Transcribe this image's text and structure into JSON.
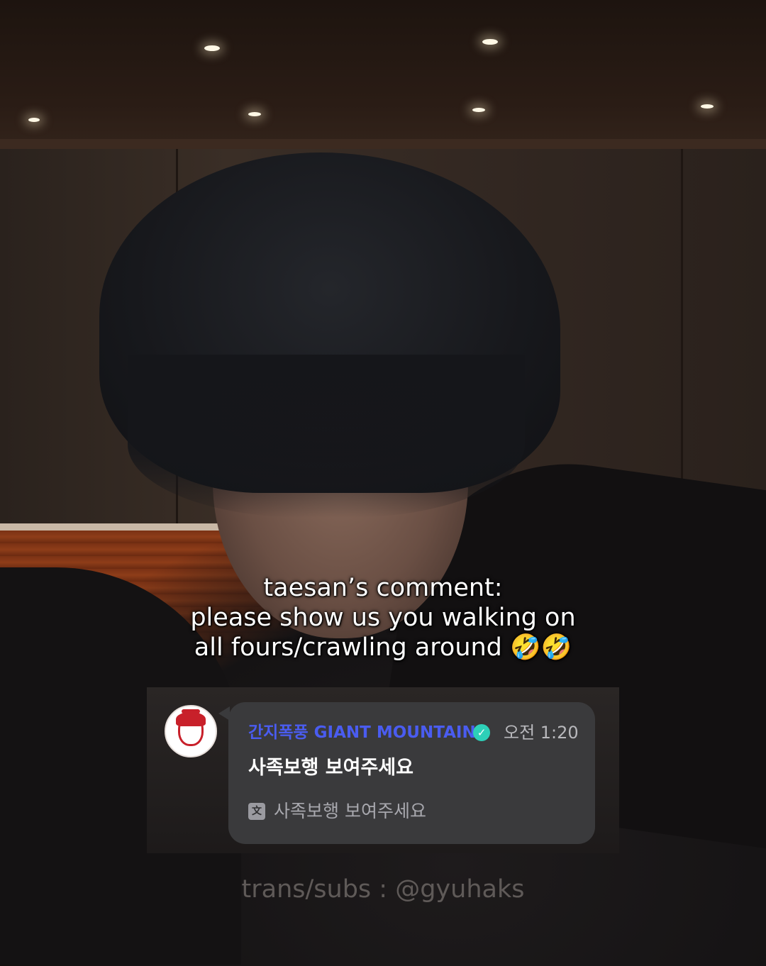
{
  "caption": {
    "line1": "taesan’s comment:",
    "line2": "please show us you walking on",
    "line3": "all fours/crawling around 🤣🤣"
  },
  "comment": {
    "username": "간지폭풍 GIANT MOUNTAIN",
    "verified_icon": "verified-check-icon",
    "time": "오전 1:20",
    "message": "사족보행 보여주세요",
    "translate_icon": "translate-icon",
    "translation": "사족보행 보여주세요"
  },
  "credit": "trans/subs : @gyuhaks",
  "colors": {
    "username": "#4a5cf0",
    "verified": "#2dd0b8",
    "bubble": "#3a3a3c"
  }
}
